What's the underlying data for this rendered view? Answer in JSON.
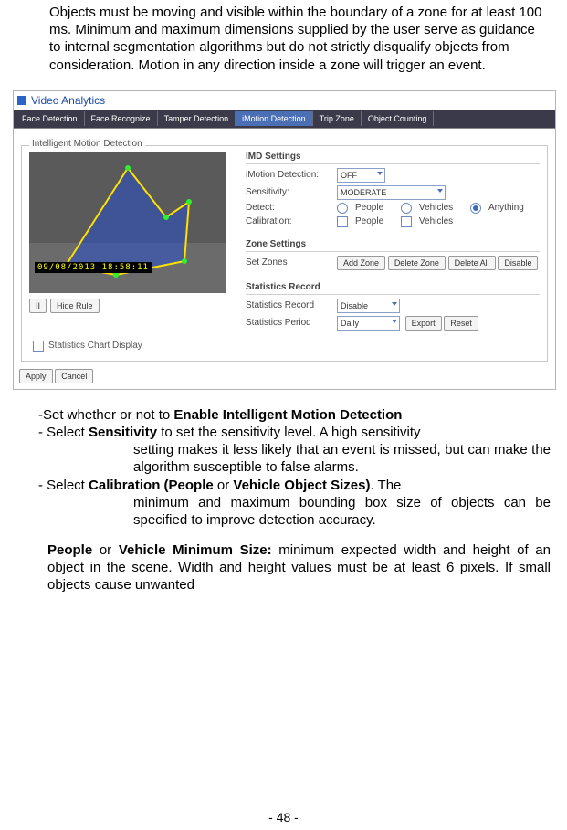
{
  "top_paragraph": "Objects must be moving and visible within the boundary of a zone for at least 100 ms. Minimum and maximum dimensions supplied by the user serve as guidance to internal segmentation algorithms but do not strictly disqualify objects from consideration. Motion in any direction inside a zone will trigger an event.",
  "shot": {
    "window_title": "Video Analytics",
    "tabs": [
      "Face Detection",
      "Face Recognize",
      "Tamper Detection",
      "iMotion Detection",
      "Trip Zone",
      "Object Counting"
    ],
    "fieldset_legend": "Intelligent Motion Detection",
    "timestamp": "09/08/2013  18:58:11",
    "preview_buttons": {
      "pause": "II",
      "hide": "Hide Rule"
    },
    "imd": {
      "heading": "IMD Settings",
      "motion_label": "iMotion Detection:",
      "motion_value": "OFF",
      "sens_label": "Sensitivity:",
      "sens_value": "MODERATE",
      "detect_label": "Detect:",
      "detect_options": {
        "people": "People",
        "vehicles": "Vehicles",
        "anything": "Anything"
      },
      "calib_label": "Calibration:",
      "calib_options": {
        "people": "People",
        "vehicles": "Vehicles"
      }
    },
    "zone": {
      "heading": "Zone Settings",
      "setzones_label": "Set Zones",
      "buttons": {
        "add": "Add Zone",
        "del": "Delete Zone",
        "delall": "Delete All",
        "disable": "Disable"
      }
    },
    "stats": {
      "heading": "Statistics Record",
      "record_label": "Statistics Record",
      "record_value": "Disable",
      "period_label": "Statistics Period",
      "period_value": "Daily",
      "buttons": {
        "export": "Export",
        "reset": "Reset"
      }
    },
    "chart_chk": "Statistics Chart Display",
    "bottom": {
      "apply": "Apply",
      "cancel": "Cancel"
    }
  },
  "lower": {
    "l1_a": "-Set whether or not to ",
    "l1_b": "Enable Intelligent Motion Detection",
    "l2_a": "- Select ",
    "l2_b": "Sensitivity",
    "l2_c": " to set the sensitivity level. A high sensitivity",
    "l2_cont": "setting makes it less likely that an event is missed, but can make the algorithm susceptible to false alarms.",
    "l3_a": "- Select ",
    "l3_b": "Calibration (People",
    "l3_c": " or ",
    "l3_d": "Vehicle Object Sizes)",
    "l3_e": ". The",
    "l3_cont": "minimum and maximum bounding box size of objects can be specified to improve detection accuracy.",
    "l4_a": "People",
    "l4_b": " or ",
    "l4_c": "Vehicle Minimum Size:",
    "l4_d": " minimum expected width and height of an object in the scene. Width and height values must be at least 6 pixels. If small objects cause unwanted"
  },
  "page_number": "- 48 -"
}
